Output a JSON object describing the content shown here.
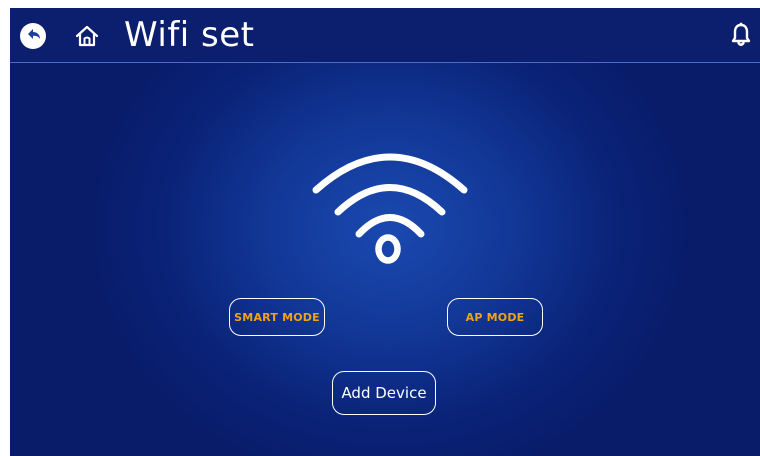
{
  "header": {
    "title": "Wifi set",
    "back_icon": "back-arrow-icon",
    "home_icon": "home-icon",
    "notification_icon": "bell-icon"
  },
  "main": {
    "wifi_icon": "wifi-icon",
    "smart_mode_label": "SMART MODE",
    "ap_mode_label": "AP MODE",
    "add_device_label": "Add Device"
  },
  "colors": {
    "background": "#0a2378",
    "header": "#0c1e6e",
    "mode_text": "#f0a21a",
    "text": "#ffffff"
  }
}
